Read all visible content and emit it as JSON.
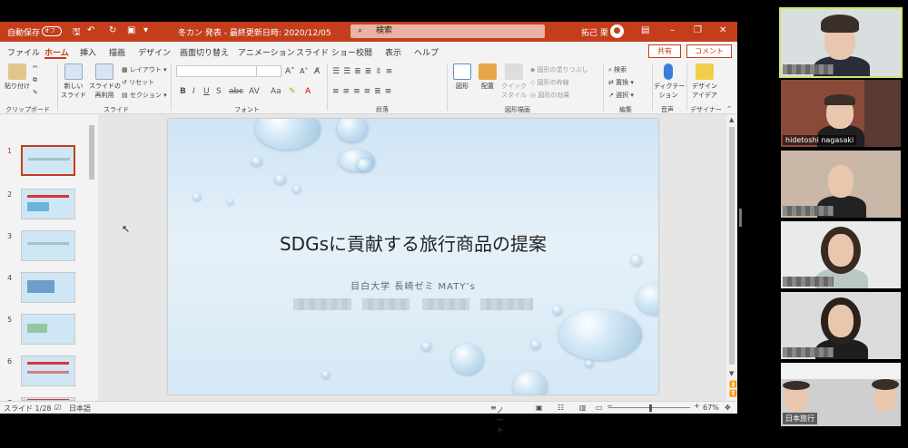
{
  "titlebar": {
    "autosave": "自動保存",
    "autosave_toggle": "オフ",
    "document": "冬カン 発表 - 最終更新日時: 2020/12/05",
    "search_placeholder": "検索",
    "user_name": "拓己 栗"
  },
  "tabs": [
    "ファイル",
    "ホーム",
    "挿入",
    "描画",
    "デザイン",
    "画面切り替え",
    "アニメーション",
    "スライド ショー",
    "校閲",
    "表示",
    "ヘルプ"
  ],
  "share_label": "共有",
  "comment_label": "コメント",
  "ribbon": {
    "paste": "貼り付け",
    "new_slide": "新しい\nスライド",
    "reuse_slide": "スライドの\n再利用",
    "layout": "レイアウト",
    "reset": "リセット",
    "section": "セクション",
    "shapes": "図形",
    "arrange": "配置",
    "quick_style": "クイック\nスタイル",
    "shape_fill": "図形の塗りつぶし",
    "shape_outline": "図形の枠線",
    "shape_effects": "図形の効果",
    "find": "検索",
    "replace": "置換",
    "select": "選択",
    "dictate": "ディクテー\nション",
    "designer": "デザイン\nアイデア",
    "groups": {
      "clipboard": "クリップボード",
      "slides": "スライド",
      "font": "フォント",
      "paragraph": "段落",
      "drawing": "図形描画",
      "editing": "編集",
      "voice": "音声",
      "designer": "デザイナー"
    }
  },
  "thumbnails": [
    {
      "num": "1"
    },
    {
      "num": "2"
    },
    {
      "num": "3"
    },
    {
      "num": "4"
    },
    {
      "num": "5"
    },
    {
      "num": "6"
    },
    {
      "num": "7"
    }
  ],
  "slide": {
    "title": "SDGsに貢献する旅行商品の提案",
    "subtitle": "目白大学 長崎ゼミ MATY’s"
  },
  "statusbar": {
    "slide_count": "スライド 1/28",
    "language": "日本語",
    "notes": "ノート",
    "zoom": "67%"
  },
  "participants": [
    {
      "name": ""
    },
    {
      "name": "hidetoshi nagasaki"
    },
    {
      "name": ""
    },
    {
      "name": ""
    },
    {
      "name": ""
    },
    {
      "name": "日本旅行"
    }
  ]
}
